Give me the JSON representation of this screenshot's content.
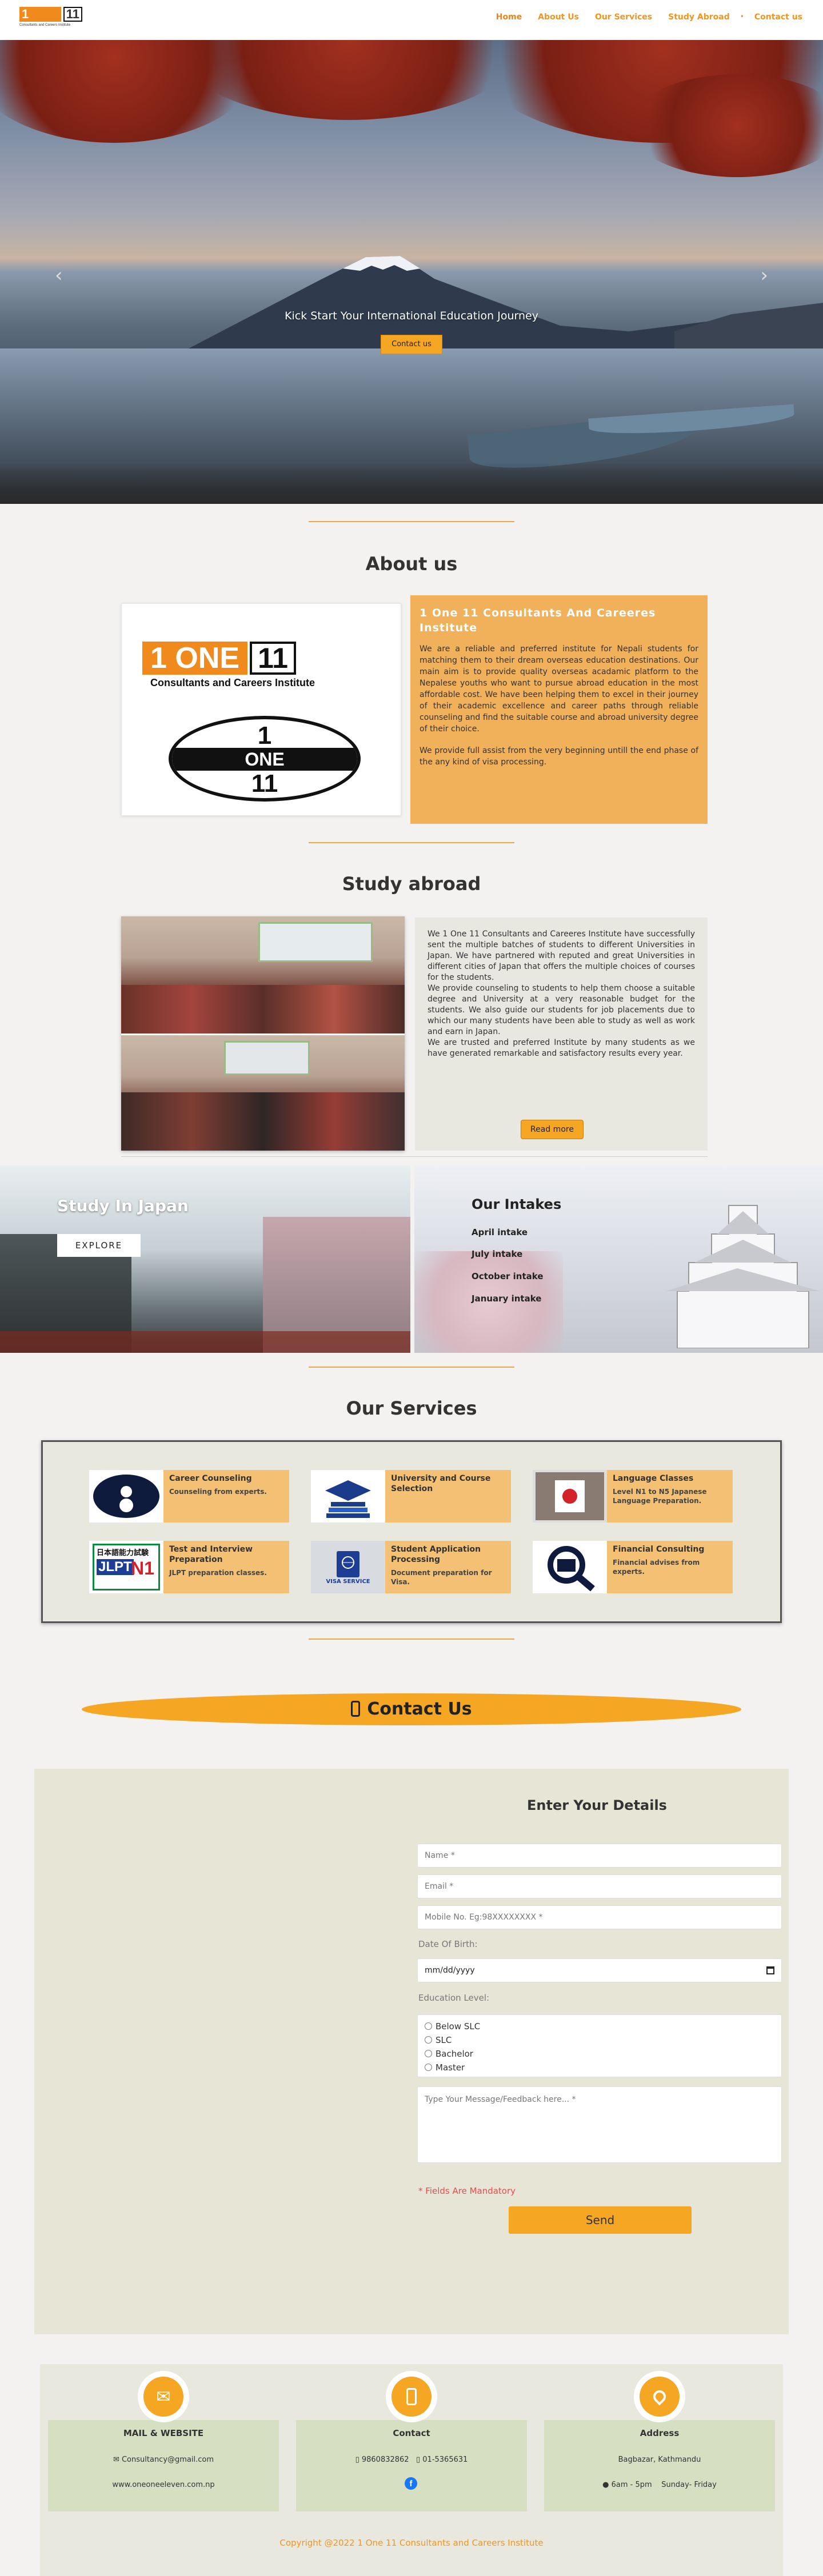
{
  "nav": {
    "logo_one": "1 ONE",
    "logo_eleven": "11",
    "logo_sub": "Consultants and Careers Institute",
    "items": [
      "Home",
      "About Us",
      "Our Services",
      "Study Abroad",
      "Contact us"
    ]
  },
  "hero": {
    "caption": "Kick Start Your International Education Journey",
    "button": "Contact us"
  },
  "about": {
    "heading": "About us",
    "logo_one": "1 ONE",
    "logo_eleven": "11",
    "logo_sub": "Consultants and Careers Institute",
    "seal_top": "1",
    "seal_mid": "ONE",
    "seal_bottom": "11",
    "title": "1 One 11 Consultants And Careeres Institute",
    "p1": "We are a reliable and preferred institute for Nepali students for matching them to their dream overseas education destinations. Our main aim is to provide quality overseas acadamic platform to the Nepalese youths who want to pursue abroad education in the most affordable cost. We have been helping them to excel in their journey of their academic excellence and career paths through reliable counseling and find the suitable course and abroad university degree of their choice.",
    "p2": "We provide full assist from the very beginning untill the end phase of the any kind of visa processing."
  },
  "study": {
    "heading": "Study abroad",
    "p1": "We 1 One 11 Consultants and Careeres Institute have successfully sent the multiple batches of students to different Universities in Japan. We have partnered with reputed and great Universities in different cities of Japan that offers the multiple choices of courses for the students.",
    "p2": "We provide counseling to students to help them choose a suitable degree and University at a very reasonable budget for the students. We also guide our students for job placements due to which our many students have been able to study as well as work and earn in Japan.",
    "p3": "We are trusted and preferred Institute by many students as we have generated remarkable and satisfactory results every year.",
    "button": "Read more"
  },
  "japan": {
    "title": "Study In Japan",
    "button": "EXPLORE"
  },
  "intakes": {
    "title": "Our Intakes",
    "items": [
      "April intake",
      "July intake",
      "October intake",
      "January intake"
    ]
  },
  "services": {
    "heading": "Our Services",
    "items": [
      {
        "title": "Career Counseling",
        "desc": "Counseling from experts."
      },
      {
        "title": "University and Course Selection",
        "desc": ""
      },
      {
        "title": "Language Classes",
        "desc": "Level N1 to N5 Japanese Language Preparation."
      },
      {
        "title": "Test and Interview Preparation",
        "desc": "JLPT preparation classes."
      },
      {
        "title": "Student Application Processing",
        "desc": "Document preparation for Visa."
      },
      {
        "title": "Financial Consulting",
        "desc": "Financial advises from experts."
      }
    ],
    "jlpt_top": "日本語能力試験",
    "jlpt_big": "JLPT",
    "jlpt_level": "N1",
    "visa_label": "VISA SERVICE"
  },
  "contact": {
    "heading": "Contact Us",
    "form_title": "Enter Your Details",
    "name_ph": "Name *",
    "email_ph": "Email *",
    "mobile_ph": "Mobile No. Eg:98XXXXXXXX  *",
    "dob_label": "Date Of Birth:",
    "dob_ph": "mm/dd/yyyy",
    "edu_label": "Education Level:",
    "edu_options": [
      "Below SLC",
      "SLC",
      "Bachelor",
      "Master"
    ],
    "msg_ph": "Type Your Message/Feedback here... *",
    "mandatory": "* Fields Are Mandatory",
    "send": "Send"
  },
  "footer": {
    "mail_title": "MAIL & WEBSITE",
    "mail": "Consultancy@gmail.com",
    "web": "www.oneoneeleven.com.np",
    "contact_title": "Contact",
    "phone1": "9860832862",
    "phone2": "01-5365631",
    "address_title": "Address",
    "address": "Bagbazar, Kathmandu",
    "hours": "6am - 5pm",
    "days": "Sunday- Friday",
    "copyright": "Copyright @2022   1 One 11 Consultants and Careers Institute"
  },
  "colors": {
    "accent": "#f5a623",
    "link": "#f0951f",
    "about_bg": "#f1b15b"
  }
}
